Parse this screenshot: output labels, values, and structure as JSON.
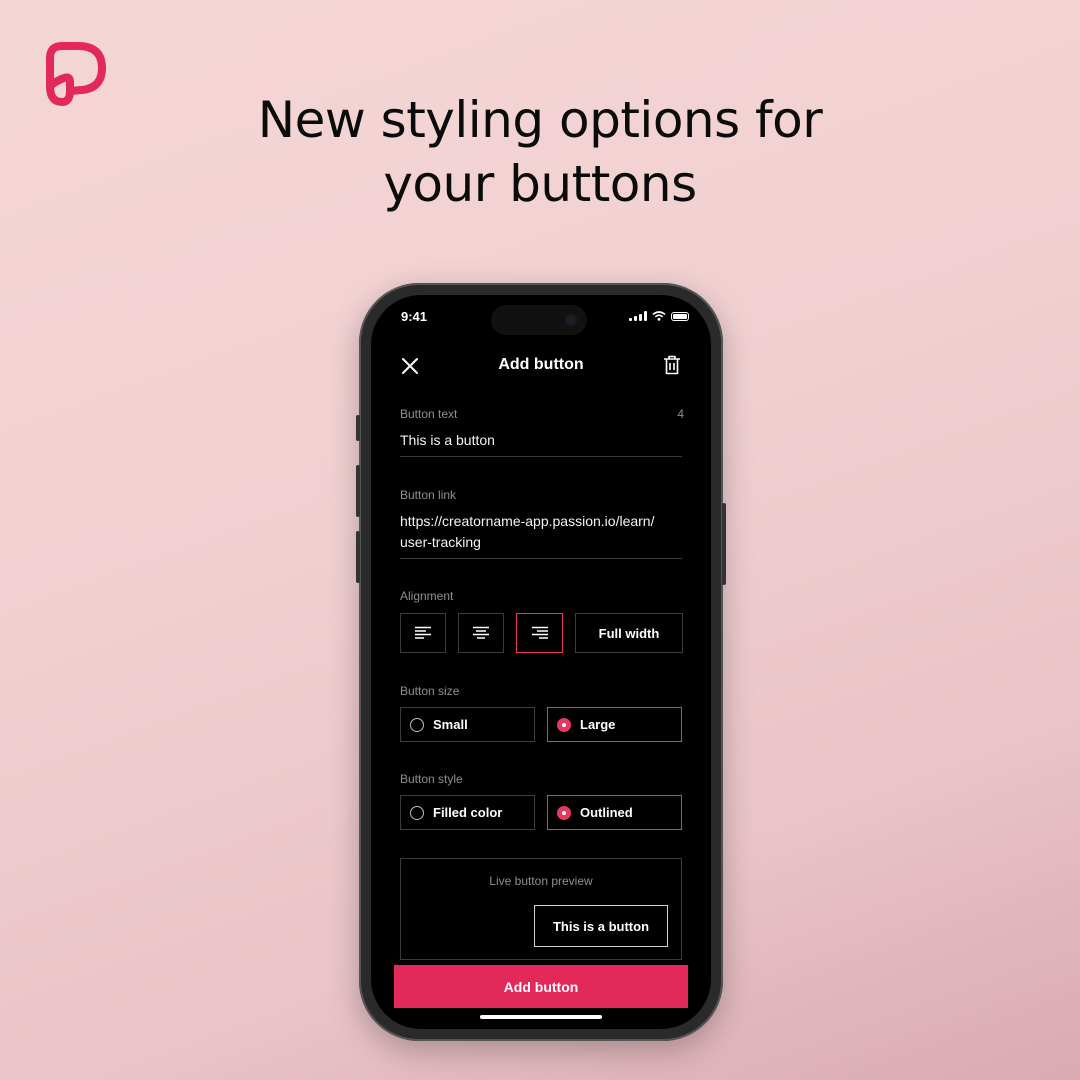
{
  "headline": {
    "line1": "New styling options for",
    "line2": "your buttons"
  },
  "brand": {
    "accent": "#e3295a"
  },
  "status_bar": {
    "time": "9:41"
  },
  "header": {
    "title": "Add button",
    "close_icon": "close-icon",
    "delete_icon": "trash-icon"
  },
  "button_text": {
    "label": "Button text",
    "count": "4",
    "value": "This is a button"
  },
  "button_link": {
    "label": "Button link",
    "value_line1": "https://creatorname-app.passion.io/learn/",
    "value_line2": "user-tracking"
  },
  "alignment": {
    "label": "Alignment",
    "options": [
      "align-left-icon",
      "align-center-icon",
      "align-right-icon"
    ],
    "full_width_label": "Full width",
    "selected": "right"
  },
  "button_size": {
    "label": "Button size",
    "options": [
      "Small",
      "Large"
    ],
    "selected": "Large"
  },
  "button_style": {
    "label": "Button style",
    "options": [
      "Filled color",
      "Outlined"
    ],
    "selected": "Outlined"
  },
  "preview": {
    "label": "Live button preview",
    "button_label": "This is a button"
  },
  "primary_action": {
    "label": "Add button"
  }
}
